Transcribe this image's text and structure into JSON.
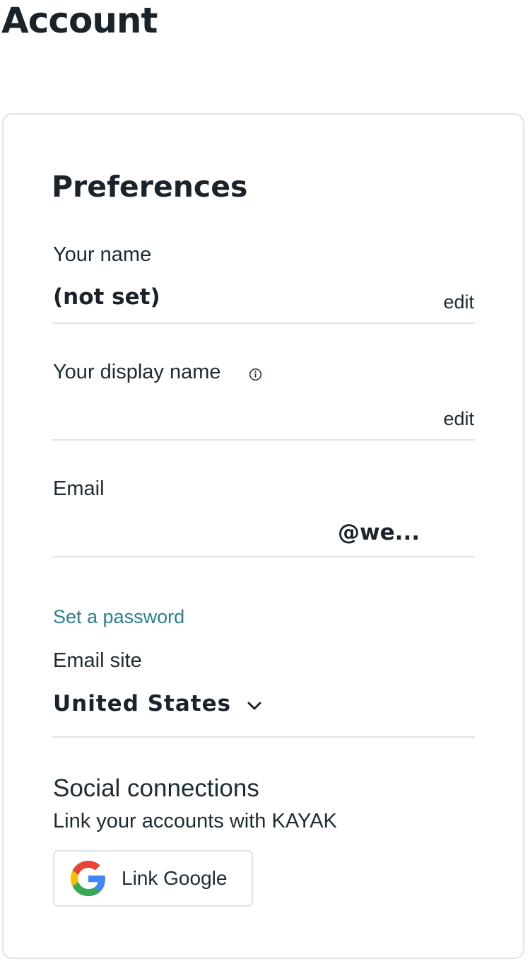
{
  "page": {
    "title": "Account"
  },
  "preferences": {
    "title": "Preferences",
    "name": {
      "label": "Your name",
      "value": "(not set)",
      "edit_label": "edit"
    },
    "display_name": {
      "label": "Your display name",
      "info_icon": "info-circle-icon",
      "edit_label": "edit"
    },
    "email": {
      "label": "Email",
      "value": "@we..."
    },
    "set_password_label": "Set a password",
    "email_site": {
      "label": "Email site",
      "selected": "United States",
      "chevron_icon": "chevron-down-icon"
    },
    "social": {
      "title": "Social connections",
      "subtitle": "Link your accounts with KAYAK",
      "google_button_label": "Link Google",
      "google_icon": "google-logo-icon"
    }
  },
  "colors": {
    "text": "#1d2b33",
    "link_teal": "#2a7f8c",
    "divider": "#e0e4e7",
    "card_border": "#dfe3e6"
  }
}
